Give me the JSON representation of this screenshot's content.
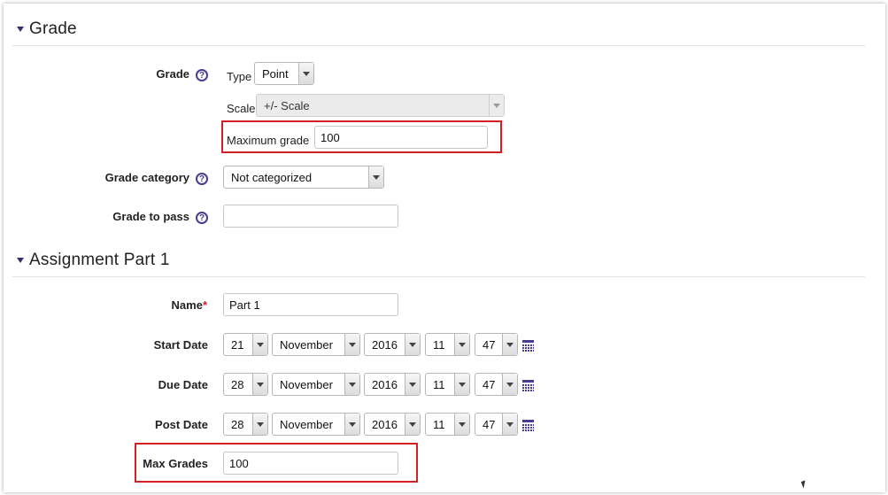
{
  "grade_section": {
    "title": "Grade",
    "grade_label": "Grade",
    "type_label": "Type",
    "type_value": "Point",
    "scale_label": "Scale",
    "scale_value": "+/- Scale",
    "max_grade_label": "Maximum grade",
    "max_grade_value": "100",
    "category_label": "Grade category",
    "category_value": "Not categorized",
    "pass_label": "Grade to pass",
    "pass_value": ""
  },
  "assignment_section": {
    "title": "Assignment Part 1",
    "name_label": "Name",
    "name_required": "*",
    "name_value": "Part 1",
    "start_label": "Start Date",
    "start": {
      "day": "21",
      "month": "November",
      "year": "2016",
      "hour": "11",
      "minute": "47"
    },
    "due_label": "Due Date",
    "due": {
      "day": "28",
      "month": "November",
      "year": "2016",
      "hour": "11",
      "minute": "47"
    },
    "post_label": "Post Date",
    "post": {
      "day": "28",
      "month": "November",
      "year": "2016",
      "hour": "11",
      "minute": "47"
    },
    "max_grades_label": "Max Grades",
    "max_grades_value": "100"
  },
  "icons": {
    "help": "?",
    "help_name": "help-icon",
    "calendar_name": "calendar-icon",
    "collapse_name": "collapse-triangle-icon"
  },
  "colors": {
    "accent": "#4b3b8f",
    "highlight": "#d32027"
  }
}
